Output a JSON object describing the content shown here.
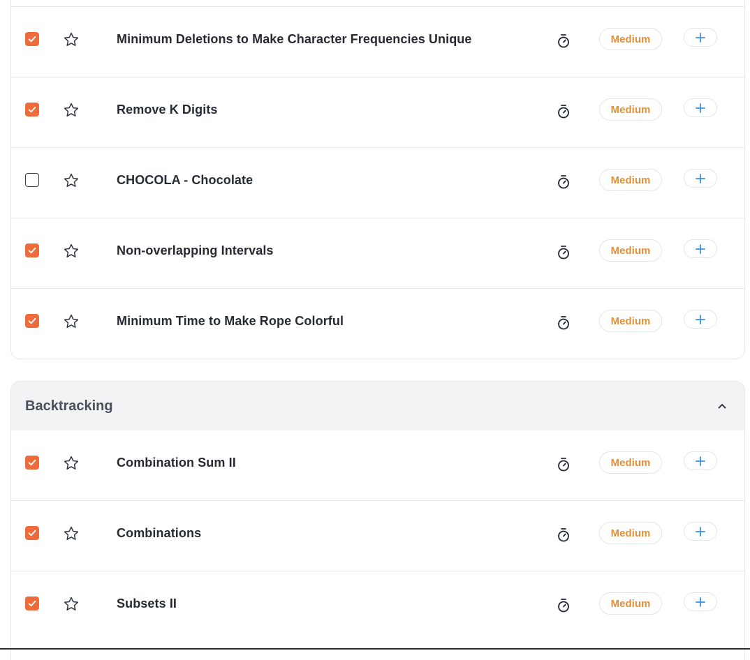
{
  "colors": {
    "checkbox_checked": "#ee6b3b",
    "difficulty_medium": "#e0913a",
    "add_icon": "#3b8ee8",
    "section_header_bg": "#f2f3f5"
  },
  "icons": {
    "checkbox": "check-icon",
    "favorite": "star-icon",
    "timer": "stopwatch-icon",
    "add": "plus-icon",
    "collapse": "chevron-up-icon"
  },
  "sections": [
    {
      "title": "",
      "problems": [
        {
          "title": "Minimum Deletions to Make Character Frequencies Unique",
          "completed": true,
          "difficulty": "Medium"
        },
        {
          "title": "Remove K Digits",
          "completed": true,
          "difficulty": "Medium"
        },
        {
          "title": "CHOCOLA - Chocolate",
          "completed": false,
          "difficulty": "Medium"
        },
        {
          "title": "Non-overlapping Intervals",
          "completed": true,
          "difficulty": "Medium"
        },
        {
          "title": "Minimum Time to Make Rope Colorful",
          "completed": true,
          "difficulty": "Medium"
        }
      ]
    },
    {
      "title": "Backtracking",
      "expanded": true,
      "problems": [
        {
          "title": "Combination Sum II",
          "completed": true,
          "difficulty": "Medium"
        },
        {
          "title": "Combinations",
          "completed": true,
          "difficulty": "Medium"
        },
        {
          "title": "Subsets II",
          "completed": true,
          "difficulty": "Medium"
        }
      ]
    }
  ]
}
